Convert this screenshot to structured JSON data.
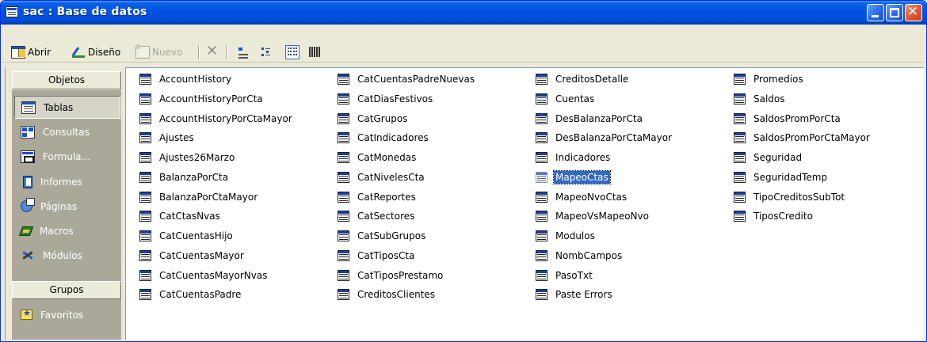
{
  "window": {
    "title": "sac : Base de datos",
    "buttons": {
      "minimize": "minimize",
      "maximize": "maximize",
      "close": "close"
    }
  },
  "toolbar": {
    "open_label": "Abrir",
    "design_label": "Diseño",
    "new_label": "Nuevo"
  },
  "sidebar": {
    "objects_header": "Objetos",
    "items": [
      {
        "label": "Tablas",
        "icon": "table-icon",
        "active": true
      },
      {
        "label": "Consultas",
        "icon": "query-icon",
        "active": false
      },
      {
        "label": "Formula...",
        "icon": "form-icon",
        "active": false
      },
      {
        "label": "Informes",
        "icon": "report-icon",
        "active": false
      },
      {
        "label": "Páginas",
        "icon": "page-icon",
        "active": false
      },
      {
        "label": "Macros",
        "icon": "macro-icon",
        "active": false
      },
      {
        "label": "Módulos",
        "icon": "module-icon",
        "active": false
      }
    ],
    "groups_header": "Grupos",
    "groups": [
      {
        "label": "Favoritos",
        "icon": "favorites-icon"
      }
    ]
  },
  "tables": {
    "columns": [
      [
        "AccountHistory",
        "AccountHistoryPorCta",
        "AccountHistoryPorCtaMayor",
        "Ajustes",
        "Ajustes26Marzo",
        "BalanzaPorCta",
        "BalanzaPorCtaMayor",
        "CatCtasNvas",
        "CatCuentasHijo",
        "CatCuentasMayor",
        "CatCuentasMayorNvas",
        "CatCuentasPadre"
      ],
      [
        "CatCuentasPadreNuevas",
        "CatDiasFestivos",
        "CatGrupos",
        "CatIndicadores",
        "CatMonedas",
        "CatNivelesCta",
        "CatReportes",
        "CatSectores",
        "CatSubGrupos",
        "CatTiposCta",
        "CatTiposPrestamo",
        "CreditosClientes"
      ],
      [
        "CreditosDetalle",
        "Cuentas",
        "DesBalanzaPorCta",
        "DesBalanzaPorCtaMayor",
        "Indicadores",
        "MapeoCtas",
        "MapeoNvoCtas",
        "MapeoVsMapeoNvo",
        "Modulos",
        "NombCampos",
        "PasoTxt",
        "Paste Errors"
      ],
      [
        "Promedios",
        "Saldos",
        "SaldosPromPorCta",
        "SaldosPromPorCtaMayor",
        "Seguridad",
        "SeguridadTemp",
        "TipoCreditosSubTot",
        "TiposCredito"
      ]
    ],
    "selected": "MapeoCtas"
  }
}
